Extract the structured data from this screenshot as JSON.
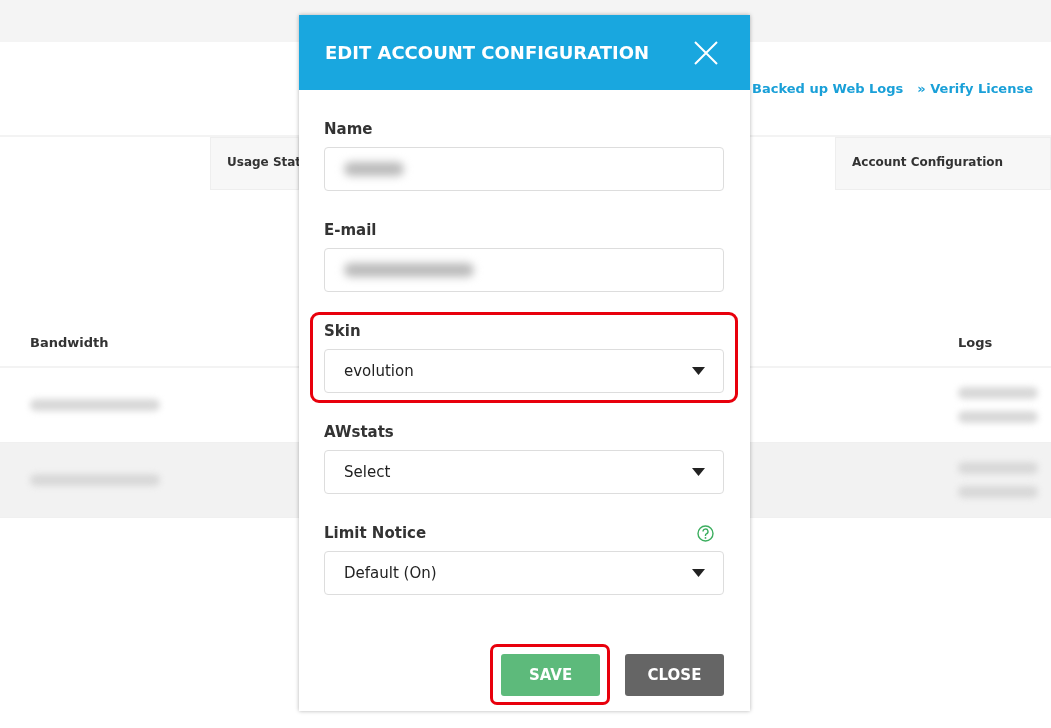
{
  "background": {
    "links": [
      "Backed up Web Logs",
      "» Verify License"
    ],
    "tabs": [
      {
        "label": "Usage Stat",
        "selected": false
      },
      {
        "label": "Account Configuration",
        "selected": false
      }
    ],
    "table": {
      "columns": [
        "Bandwidth",
        "Logs"
      ],
      "rows": [
        {
          "shaded": false
        },
        {
          "shaded": true
        }
      ]
    }
  },
  "dialog": {
    "title": "EDIT ACCOUNT CONFIGURATION",
    "fields": [
      {
        "label": "Name",
        "kind": "text",
        "highlighted": false,
        "help": false
      },
      {
        "label": "E-mail",
        "kind": "text",
        "highlighted": false,
        "help": false
      },
      {
        "label": "Skin",
        "kind": "select",
        "value": "evolution",
        "highlighted": true,
        "help": false
      },
      {
        "label": "AWstats",
        "kind": "select",
        "value": "Select",
        "highlighted": false,
        "help": false
      },
      {
        "label": "Limit Notice",
        "kind": "select",
        "value": "Default (On)",
        "highlighted": false,
        "help": true
      }
    ],
    "buttons": [
      {
        "label": "SAVE",
        "kind": "primary",
        "highlighted": true
      },
      {
        "label": "CLOSE",
        "kind": "secondary",
        "highlighted": false
      }
    ]
  }
}
